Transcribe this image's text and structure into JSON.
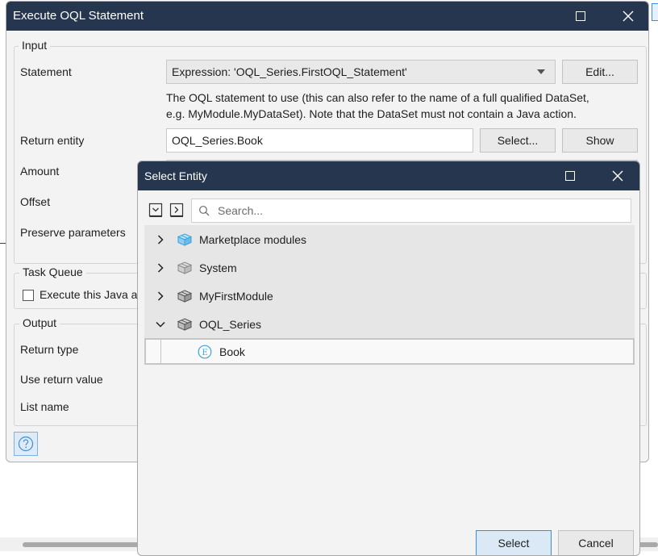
{
  "main_dialog": {
    "title": "Execute OQL Statement",
    "input_group": {
      "legend": "Input",
      "statement_label": "Statement",
      "statement_value": "Expression: 'OQL_Series.FirstOQL_Statement'",
      "edit_button": "Edit...",
      "description_line1": "The OQL statement to use (this can also refer to the name of a full qualified DataSet,",
      "description_line2": "e.g. MyModule.MyDataSet). Note that the DataSet must not contain a Java action.",
      "return_entity_label": "Return entity",
      "return_entity_value": "OQL_Series.Book",
      "select_button": "Select...",
      "show_button": "Show",
      "amount_label": "Amount",
      "offset_label": "Offset",
      "preserve_label": "Preserve parameters"
    },
    "task_queue_group": {
      "legend": "Task Queue",
      "execute_label": "Execute this Java a"
    },
    "output_group": {
      "legend": "Output",
      "return_type_label": "Return type",
      "use_return_label": "Use return value",
      "list_name_label": "List name"
    }
  },
  "select_entity_dialog": {
    "title": "Select Entity",
    "search_placeholder": "Search...",
    "tree": [
      {
        "label": "Marketplace modules",
        "icon": "marketplace-module-icon",
        "expanded": false
      },
      {
        "label": "System",
        "icon": "module-icon",
        "expanded": false
      },
      {
        "label": "MyFirstModule",
        "icon": "module-icon",
        "expanded": false
      },
      {
        "label": "OQL_Series",
        "icon": "module-icon",
        "expanded": true
      },
      {
        "label": "Book",
        "icon": "entity-icon",
        "selected": true
      }
    ],
    "select_button": "Select",
    "cancel_button": "Cancel"
  },
  "colors": {
    "titlebar": "#26364e",
    "accent": "#3b8ed8",
    "dialog_bg": "#f3f3f3"
  }
}
